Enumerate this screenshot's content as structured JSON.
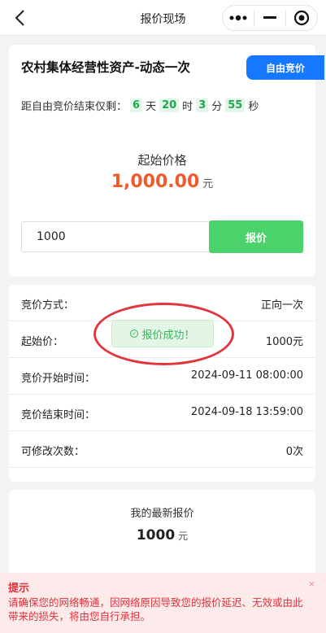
{
  "nav": {
    "title": "报价现场"
  },
  "asset": {
    "title": "农村集体经营性资产-动态一次",
    "mode_label": "自由竞价"
  },
  "countdown": {
    "prefix": "距自由竞价结束仅剩：",
    "days": "6",
    "days_unit": "天",
    "hours": "20",
    "hours_unit": "时",
    "minutes": "3",
    "minutes_unit": "分",
    "seconds": "55",
    "seconds_unit": "秒"
  },
  "start_price": {
    "label": "起始价格",
    "value": "1,000.00",
    "unit": "元"
  },
  "bid": {
    "input_value": "1000",
    "button_label": "报价"
  },
  "details": [
    {
      "label": "竞价方式：",
      "value": "正向一次"
    },
    {
      "label": "起始价：",
      "value": "1000元"
    },
    {
      "label": "竞价开始时间：",
      "value": "2024-09-11 08:00:00"
    },
    {
      "label": "竞价结束时间：",
      "value": "2024-09-18 13:59:00"
    },
    {
      "label": "可修改次数：",
      "value": "0次"
    }
  ],
  "toast": {
    "icon": "check-circle-icon",
    "text": "报价成功！"
  },
  "latest": {
    "label": "我的最新报价",
    "value": "1000",
    "unit": "元"
  },
  "notice": {
    "title": "提示",
    "text": "请确保您的网络畅通，因网络原因导致您的报价延迟、无效或由此带来的损失，将由您自行承担。",
    "close": "×"
  },
  "colors": {
    "accent_blue": "#1677ff",
    "bid_green": "#4cd26a",
    "price_orange": "#f05a2b",
    "alert_red": "#e0313b"
  }
}
